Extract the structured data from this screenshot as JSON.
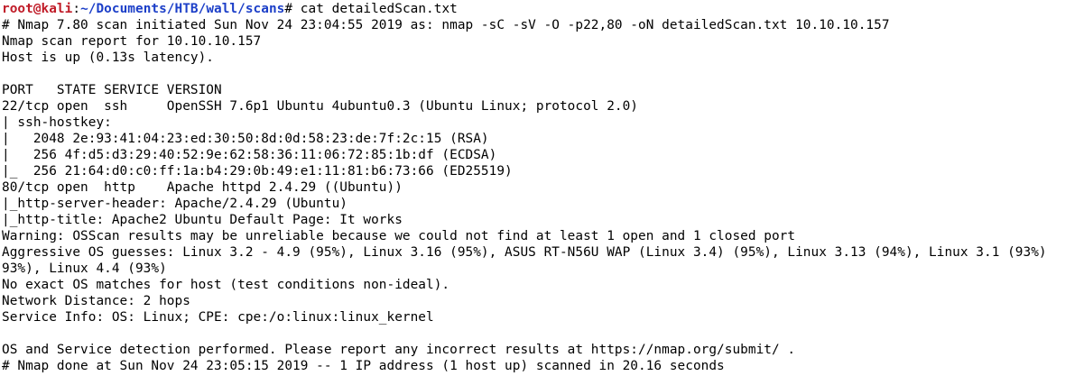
{
  "terminal": {
    "prompt": {
      "user_host": "root@kali",
      "separator": ":",
      "path": "~/Documents/HTB/wall/scans",
      "symbol": "# ",
      "command": "cat detailedScan.txt"
    },
    "lines": [
      "# Nmap 7.80 scan initiated Sun Nov 24 23:04:55 2019 as: nmap -sC -sV -O -p22,80 -oN detailedScan.txt 10.10.10.157",
      "Nmap scan report for 10.10.10.157",
      "Host is up (0.13s latency).",
      "",
      "PORT   STATE SERVICE VERSION",
      "22/tcp open  ssh     OpenSSH 7.6p1 Ubuntu 4ubuntu0.3 (Ubuntu Linux; protocol 2.0)",
      "| ssh-hostkey: ",
      "|   2048 2e:93:41:04:23:ed:30:50:8d:0d:58:23:de:7f:2c:15 (RSA)",
      "|   256 4f:d5:d3:29:40:52:9e:62:58:36:11:06:72:85:1b:df (ECDSA)",
      "|_  256 21:64:d0:c0:ff:1a:b4:29:0b:49:e1:11:81:b6:73:66 (ED25519)",
      "80/tcp open  http    Apache httpd 2.4.29 ((Ubuntu))",
      "|_http-server-header: Apache/2.4.29 (Ubuntu)",
      "|_http-title: Apache2 Ubuntu Default Page: It works",
      "Warning: OSScan results may be unreliable because we could not find at least 1 open and 1 closed port",
      "Aggressive OS guesses: Linux 3.2 - 4.9 (95%), Linux 3.16 (95%), ASUS RT-N56U WAP (Linux 3.4) (95%), Linux 3.13 (94%), Linux 3.1 (93%)",
      "93%), Linux 4.4 (93%)",
      "No exact OS matches for host (test conditions non-ideal).",
      "Network Distance: 2 hops",
      "Service Info: OS: Linux; CPE: cpe:/o:linux:linux_kernel",
      "",
      "OS and Service detection performed. Please report any incorrect results at https://nmap.org/submit/ .",
      "# Nmap done at Sun Nov 24 23:05:15 2019 -- 1 IP address (1 host up) scanned in 20.16 seconds"
    ]
  },
  "colors": {
    "background": "#ffffff",
    "text": "#000000",
    "prompt_user": "#c01c28",
    "prompt_path": "#1c3fc8"
  }
}
